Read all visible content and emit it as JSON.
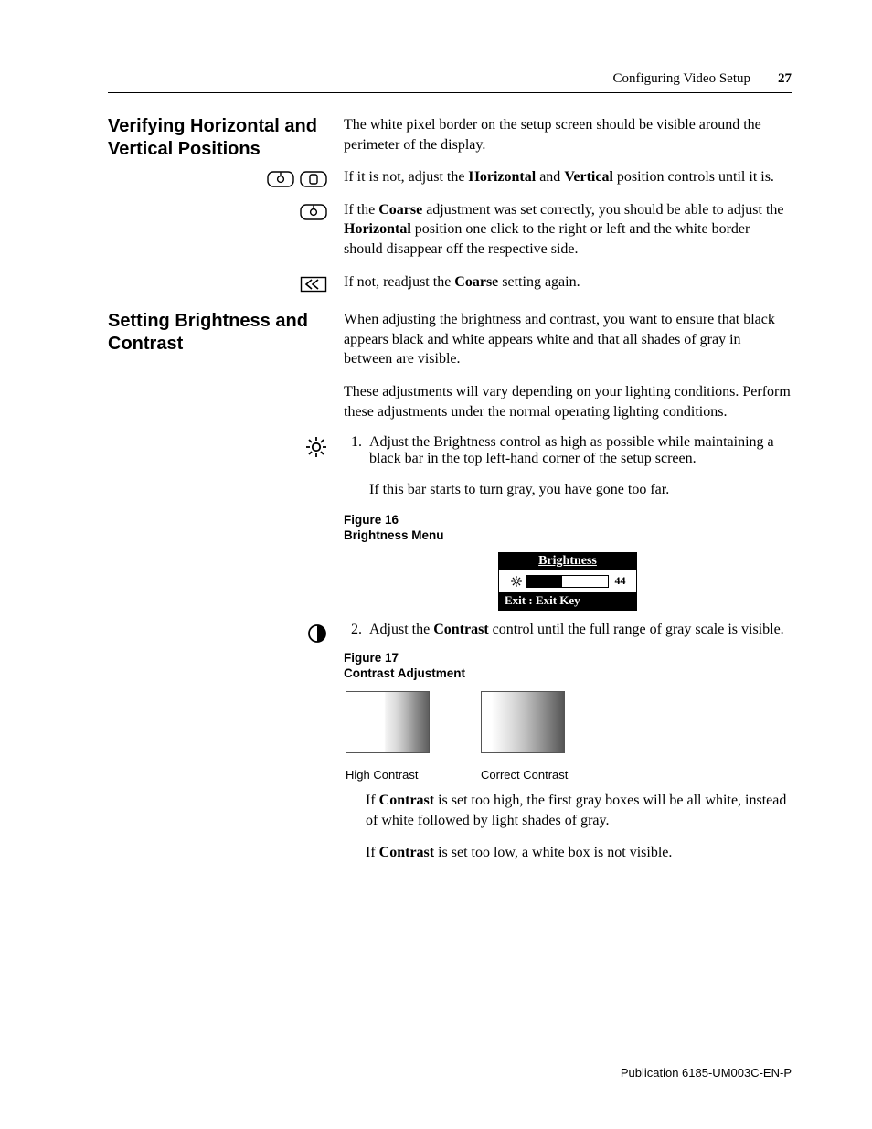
{
  "header": {
    "section": "Configuring Video Setup",
    "page": "27"
  },
  "sec1": {
    "title": "Verifying Horizontal and Vertical Positions",
    "p1": "The white pixel border on the setup screen should be visible around the perimeter of the display.",
    "p2a": "If it is not, adjust the ",
    "p2hz": "Horizontal",
    "p2b": " and ",
    "p2vt": "Vertical",
    "p2c": " position controls until it is.",
    "p3a": "If the ",
    "p3co": "Coarse",
    "p3b": " adjustment was set correctly, you should be able to adjust the ",
    "p3hz": "Horizontal",
    "p3c": " position one click to the right or left and the white border should disappear off the respective side.",
    "p4a": "If not, readjust the ",
    "p4co": "Coarse",
    "p4b": " setting again."
  },
  "sec2": {
    "title": "Setting Brightness and Contrast",
    "p1": "When adjusting the brightness and contrast, you want to ensure that black appears black and white appears white and that all shades of gray in between are visible.",
    "p2": "These adjustments will vary depending on your lighting conditions. Perform these adjustments under the normal operating lighting conditions.",
    "step1": "Adjust the Brightness control as high as possible while maintaining a black bar in the top left-hand corner of the setup screen.",
    "step1b": "If this bar starts to turn gray, you have gone too far.",
    "fig16n": "Figure 16",
    "fig16t": "Brightness Menu",
    "osd": {
      "title": "Brightness",
      "value": "44",
      "foot": "Exit : Exit Key"
    },
    "step2a": "Adjust the ",
    "step2co": "Contrast",
    "step2b": " control until the full range of gray scale is visible.",
    "fig17n": "Figure 17",
    "fig17t": "Contrast Adjustment",
    "labelHigh": "High Contrast",
    "labelCorrect": "Correct Contrast",
    "p3a": "If ",
    "p3co": "Contrast",
    "p3b": " is set too high, the first gray boxes will be all white, instead of white followed by light shades of gray.",
    "p4a": "If ",
    "p4co": "Contrast",
    "p4b": " is set too low, a white box is not visible."
  },
  "footer": {
    "pub": "Publication 6185-UM003C-EN-P"
  },
  "chart_data": {
    "type": "bar",
    "title": "Brightness",
    "categories": [
      "Brightness"
    ],
    "values": [
      44
    ],
    "ylim": [
      0,
      100
    ],
    "xlabel": "",
    "ylabel": ""
  }
}
